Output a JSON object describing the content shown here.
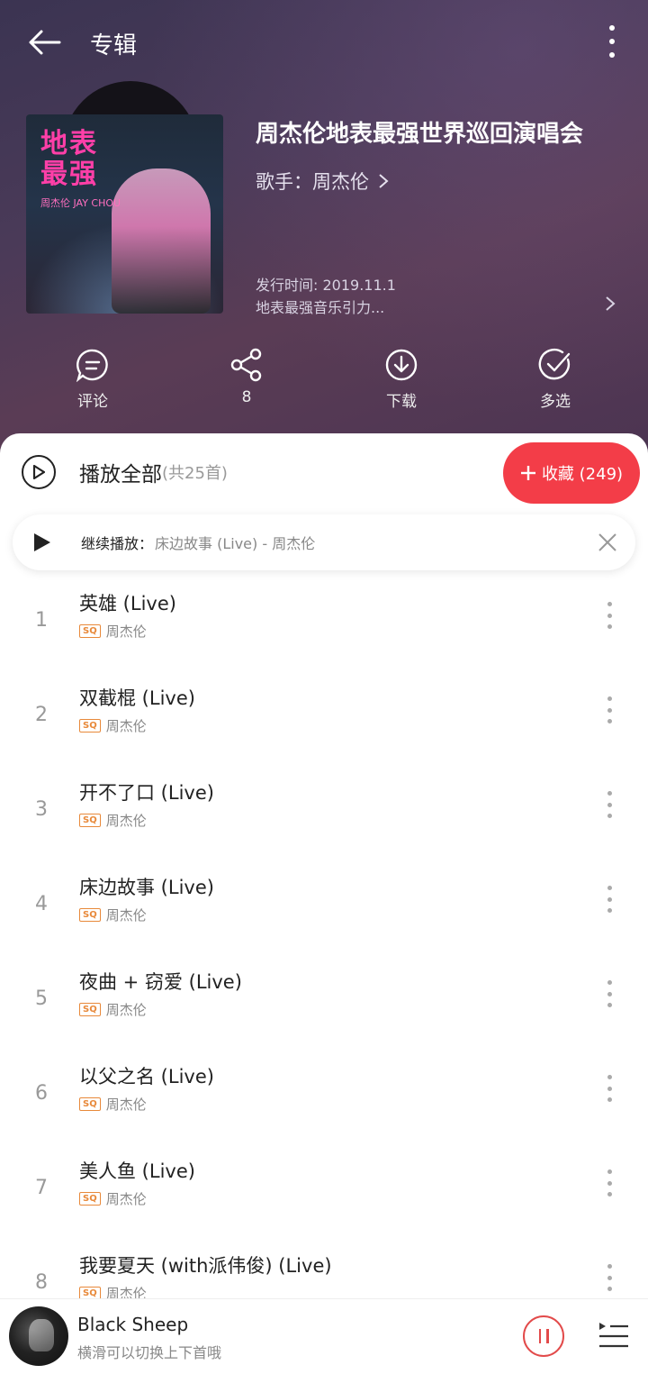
{
  "header": {
    "title": "专辑"
  },
  "album": {
    "name": "周杰伦地表最强世界巡回演唱会",
    "artist_label": "歌手：周杰伦",
    "release": "发行时间: 2019.11.1",
    "description": "地表最强音乐引力...",
    "cover_text": "地表\n最强",
    "cover_sub": "周杰伦 JAY CHOU"
  },
  "actions": [
    {
      "label": "评论",
      "icon": "comment-icon"
    },
    {
      "label": "8",
      "icon": "share-icon"
    },
    {
      "label": "下载",
      "icon": "download-icon"
    },
    {
      "label": "多选",
      "icon": "multi-select-icon"
    }
  ],
  "list": {
    "play_all": "播放全部",
    "count": "(共25首)",
    "collect_label": "收藏 (249)"
  },
  "continue": {
    "label": "继续播放：",
    "song": "床边故事 (Live) - 周杰伦"
  },
  "tracks": [
    {
      "num": "1",
      "name": "英雄 (Live)",
      "quality": "SQ",
      "artist": "周杰伦"
    },
    {
      "num": "2",
      "name": "双截棍 (Live)",
      "quality": "SQ",
      "artist": "周杰伦"
    },
    {
      "num": "3",
      "name": "开不了口 (Live)",
      "quality": "SQ",
      "artist": "周杰伦"
    },
    {
      "num": "4",
      "name": "床边故事 (Live)",
      "quality": "SQ",
      "artist": "周杰伦"
    },
    {
      "num": "5",
      "name": "夜曲 + 窃爱 (Live)",
      "quality": "SQ",
      "artist": "周杰伦"
    },
    {
      "num": "6",
      "name": "以父之名 (Live)",
      "quality": "SQ",
      "artist": "周杰伦"
    },
    {
      "num": "7",
      "name": "美人鱼 (Live)",
      "quality": "SQ",
      "artist": "周杰伦"
    },
    {
      "num": "8",
      "name": "我要夏天 (with派伟俊) (Live)",
      "quality": "SQ",
      "artist": "周杰伦"
    }
  ],
  "player": {
    "title": "Black Sheep",
    "subtitle": "横滑可以切换上下首哦"
  },
  "colors": {
    "accent": "#f33d48",
    "sq_badge": "#e8893a"
  }
}
